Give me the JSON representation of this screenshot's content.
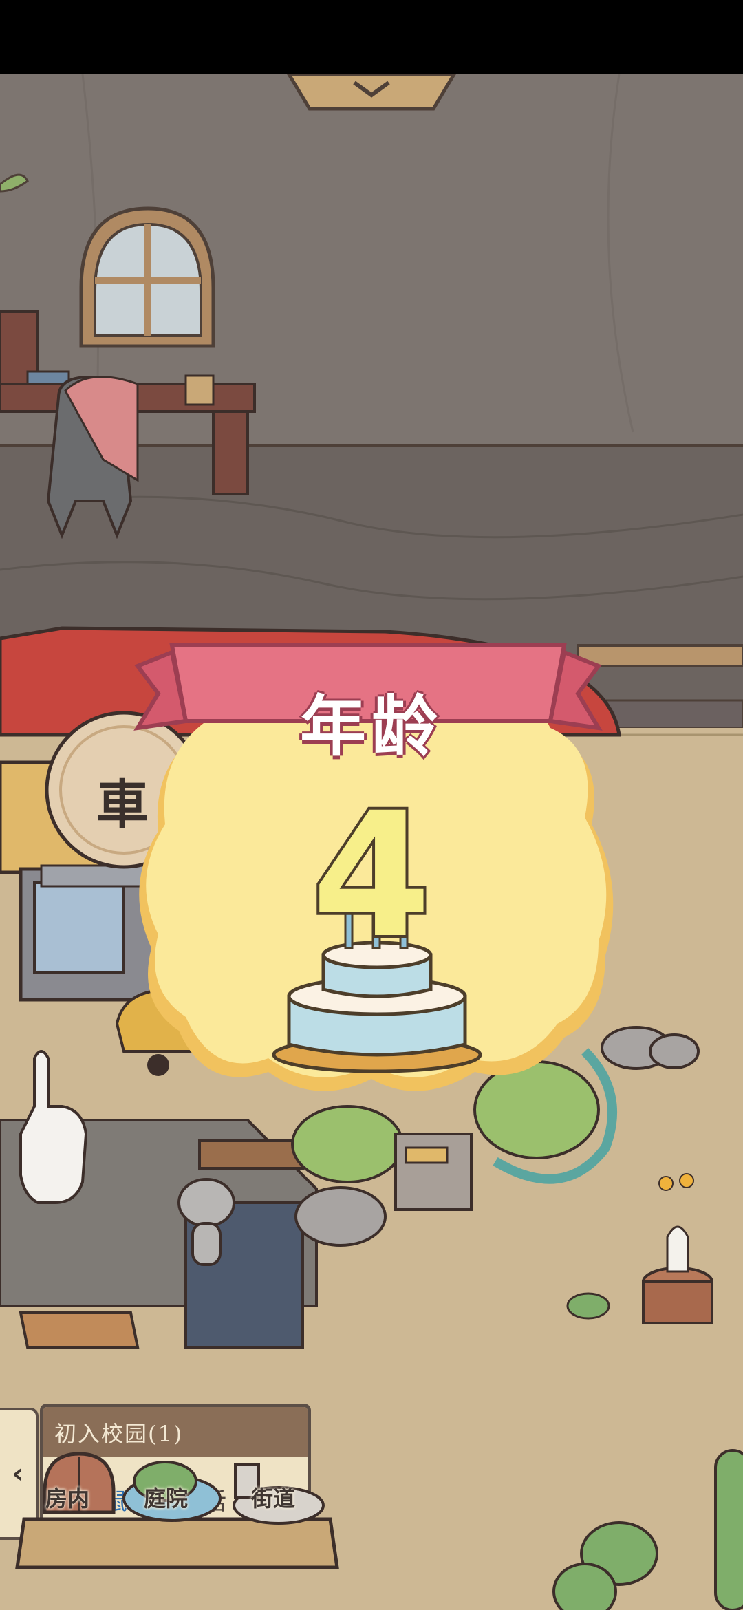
{
  "popup": {
    "title": "年龄",
    "age": "4"
  },
  "scene": {
    "sign_text": "車"
  },
  "quest": {
    "collapse_arrow": "‹",
    "title": "初入校园(1)",
    "desc_prefix": "与",
    "desc_highlight": "老鼠奶奶",
    "desc_suffix": "对话"
  },
  "nav": {
    "items": [
      {
        "label": "房内",
        "icon": "door-icon"
      },
      {
        "label": "庭院",
        "icon": "garden-icon"
      },
      {
        "label": "街道",
        "icon": "mailbox-icon"
      }
    ]
  },
  "colors": {
    "ribbon": "#e57384",
    "cloud": "#fbe99a",
    "panel": "#efe3c5",
    "highlight": "#2f6fb0"
  }
}
